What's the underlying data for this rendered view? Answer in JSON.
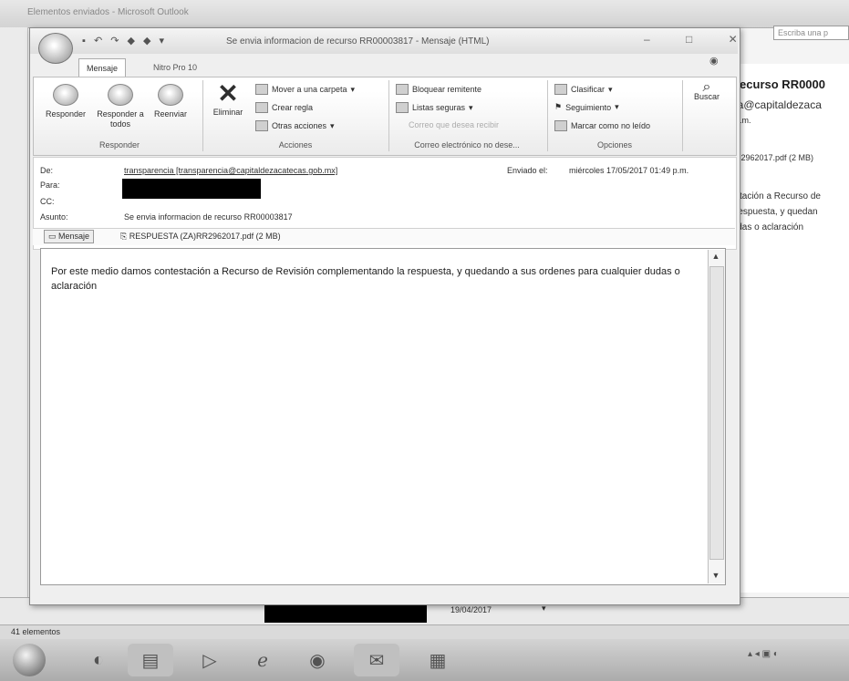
{
  "background": {
    "title": "Elementos enviados - Microsoft Outlook",
    "search_placeholder": "Escriba una p",
    "reading_pane": {
      "subject": "recurso RR0000",
      "sender": "ia@capitaldezaca",
      "time": "p.m.",
      "attachment": "R2962017.pdf (2 MB)",
      "lines": [
        "stación a  Recurso de",
        "respuesta, y quedan",
        "idas o aclaración"
      ]
    },
    "list_date": "19/04/2017",
    "status": "41 elementos"
  },
  "window": {
    "title": "Se envia informacion de recurso RR00003817 - Mensaje (HTML)",
    "controls": "– □ ✕"
  },
  "tabs": [
    {
      "label": "Mensaje"
    },
    {
      "label": "Nitro Pro 10"
    }
  ],
  "ribbon": {
    "responder_group": {
      "label": "Responder",
      "reply": "Responder",
      "reply_all": "Responder a todos",
      "forward": "Reenviar"
    },
    "acciones_group": {
      "label": "Acciones",
      "delete": "Eliminar",
      "move": "Mover a una carpeta",
      "create_rule": "Crear regla",
      "other_actions": "Otras acciones"
    },
    "junk_group": {
      "label": "Correo electrónico no dese...",
      "block_sender": "Bloquear remitente",
      "safe_lists": "Listas seguras",
      "not_junk": "Correo que desea recibir"
    },
    "options_group": {
      "label": "Opciones",
      "categorize": "Clasificar",
      "followup": "Seguimiento",
      "mark_unread": "Marcar como no leído"
    },
    "find": "Buscar"
  },
  "header": {
    "from_label": "De:",
    "from_value": "transparencia [transparencia@capitaldezacatecas.gob.mx]",
    "to_label": "Para:",
    "cc_label": "CC:",
    "subject_label": "Asunto:",
    "subject_value": "Se envia informacion de recurso RR00003817",
    "sent_label": "Enviado el:",
    "sent_value": "miércoles 17/05/2017 01:49 p.m."
  },
  "attachments": {
    "message_tab": "Mensaje",
    "file": "RESPUESTA (ZA)RR2962017.pdf (2 MB)"
  },
  "body": {
    "text": "Por este medio damos contestación a  Recurso de Revisión complementando la respuesta, y quedando a sus ordenes para cualquier dudas o aclaración"
  }
}
